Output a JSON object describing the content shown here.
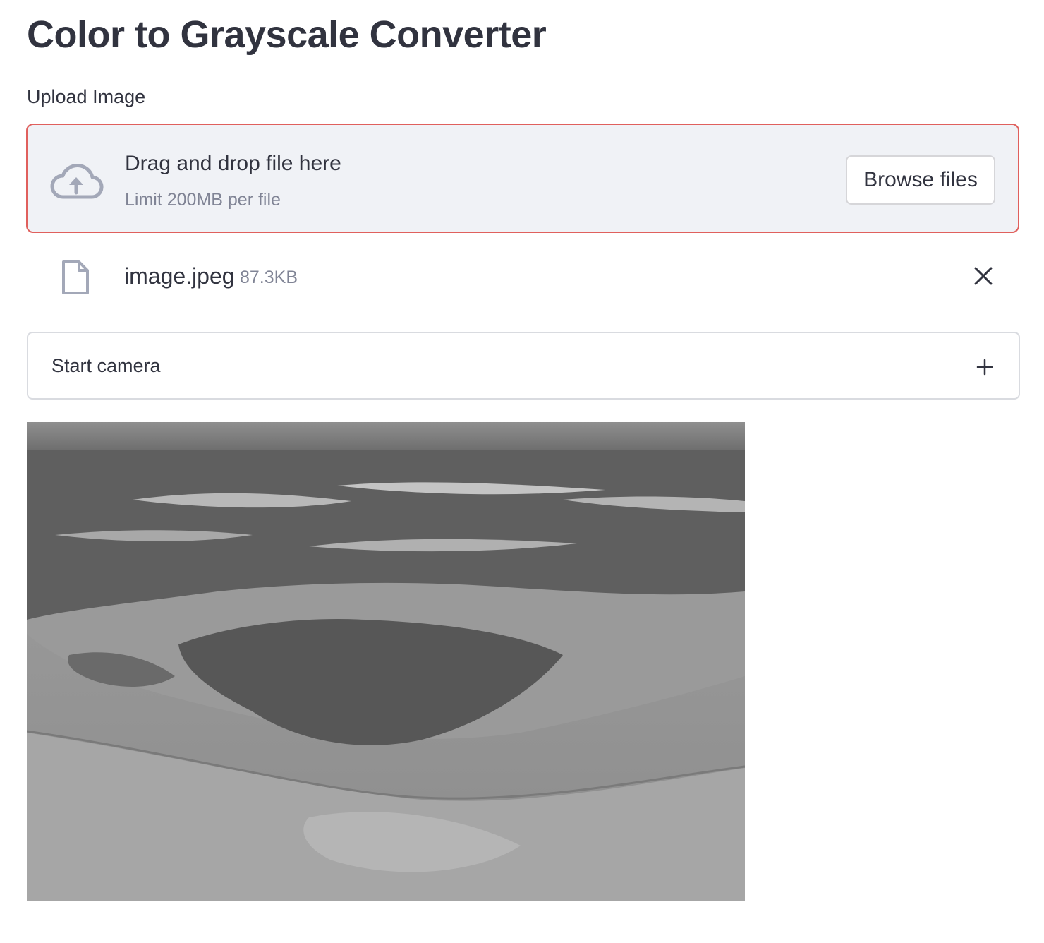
{
  "page": {
    "title": "Color to Grayscale Converter"
  },
  "uploader": {
    "label": "Upload Image",
    "drop_text": "Drag and drop file here",
    "limit_text": "Limit 200MB per file",
    "browse_label": "Browse files",
    "upload_icon": "cloud-upload-icon",
    "accent_color": "#e0605d",
    "background_color": "#f0f2f6"
  },
  "uploaded_file": {
    "name": "image.jpeg",
    "size": "87.3KB",
    "file_icon": "file-icon",
    "remove_icon": "close-icon"
  },
  "camera": {
    "label": "Start camera",
    "expand_icon": "plus-icon"
  },
  "result": {
    "type": "grayscale aerial photograph"
  }
}
